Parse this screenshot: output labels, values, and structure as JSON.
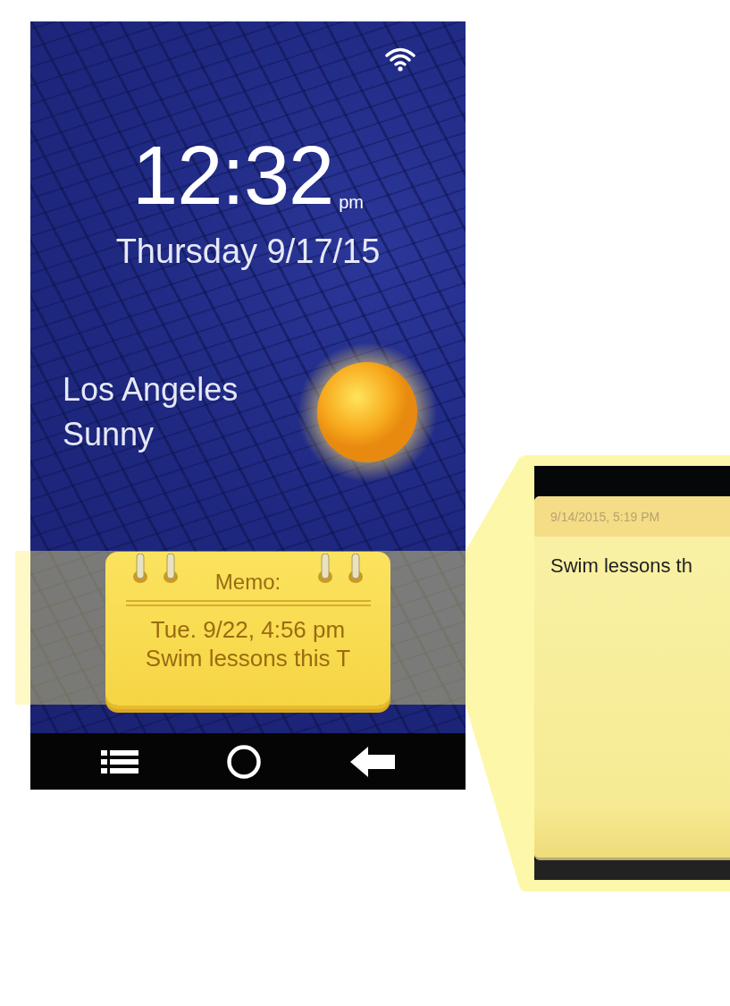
{
  "clock": {
    "time": "12:32",
    "period": "pm",
    "date": "Thursday 9/17/15"
  },
  "weather": {
    "city": "Los Angeles",
    "condition": "Sunny"
  },
  "memo_widget": {
    "title": "Memo:",
    "date": "Tue. 9/22, 4:56 pm",
    "text": "Swim lessons this T"
  },
  "memo_detail": {
    "timestamp": "9/14/2015, 5:19 PM",
    "text": "Swim lessons th"
  }
}
